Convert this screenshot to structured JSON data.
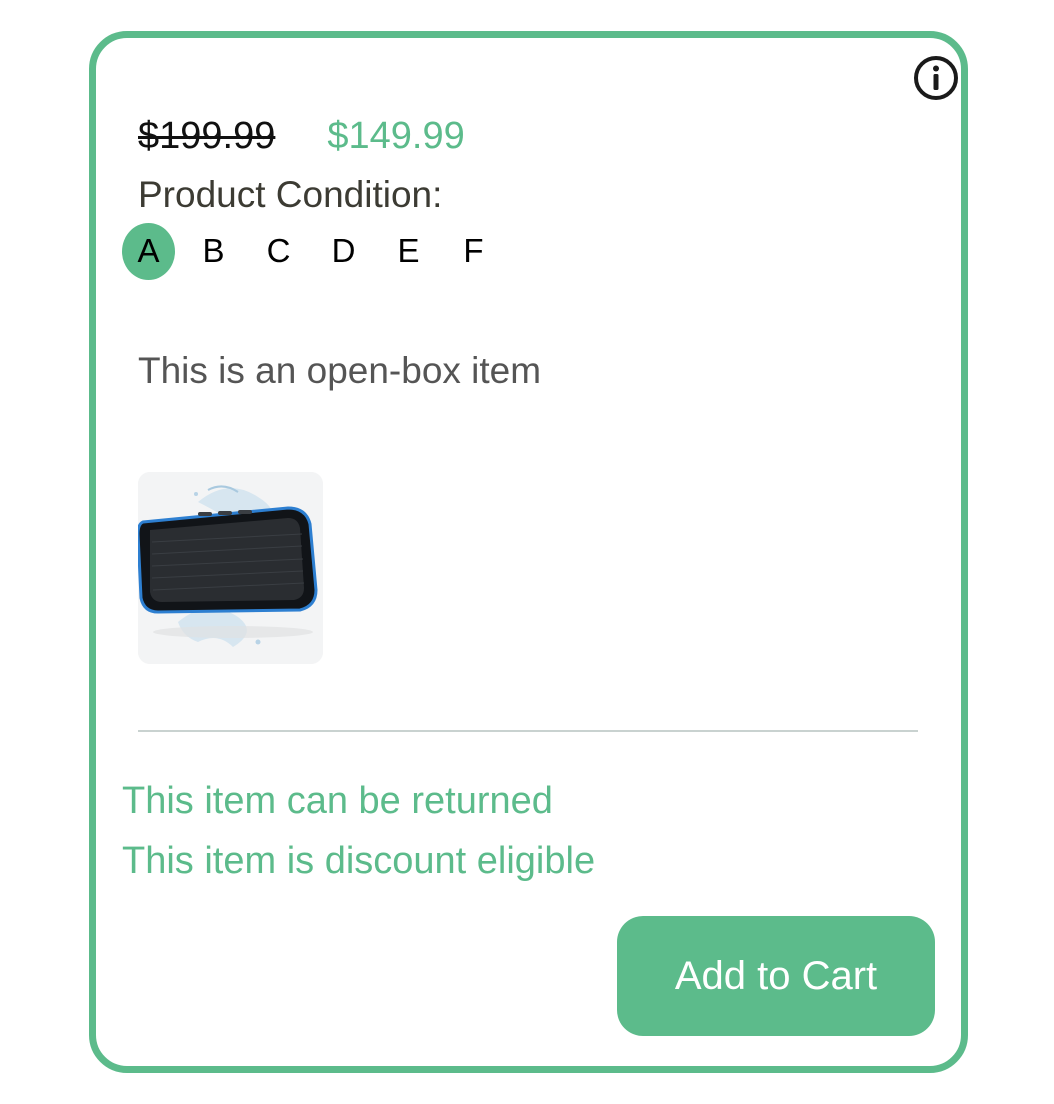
{
  "price": {
    "original": "$199.99",
    "sale": "$149.99"
  },
  "condition": {
    "label": "Product Condition:",
    "options": [
      "A",
      "B",
      "C",
      "D",
      "E",
      "F"
    ],
    "selected": "A",
    "description": "This is an open-box item"
  },
  "product": {
    "image_icon": "bluetooth-speaker-image"
  },
  "notes": {
    "returnable": "This item can be returned",
    "discount": "This item is discount eligible"
  },
  "actions": {
    "add_to_cart": "Add to Cart"
  },
  "icons": {
    "info": "info-icon"
  },
  "colors": {
    "accent": "#5cbb8b",
    "text_dark": "#3c3b33",
    "text_muted": "#555555",
    "divider": "#c9d2d0"
  }
}
